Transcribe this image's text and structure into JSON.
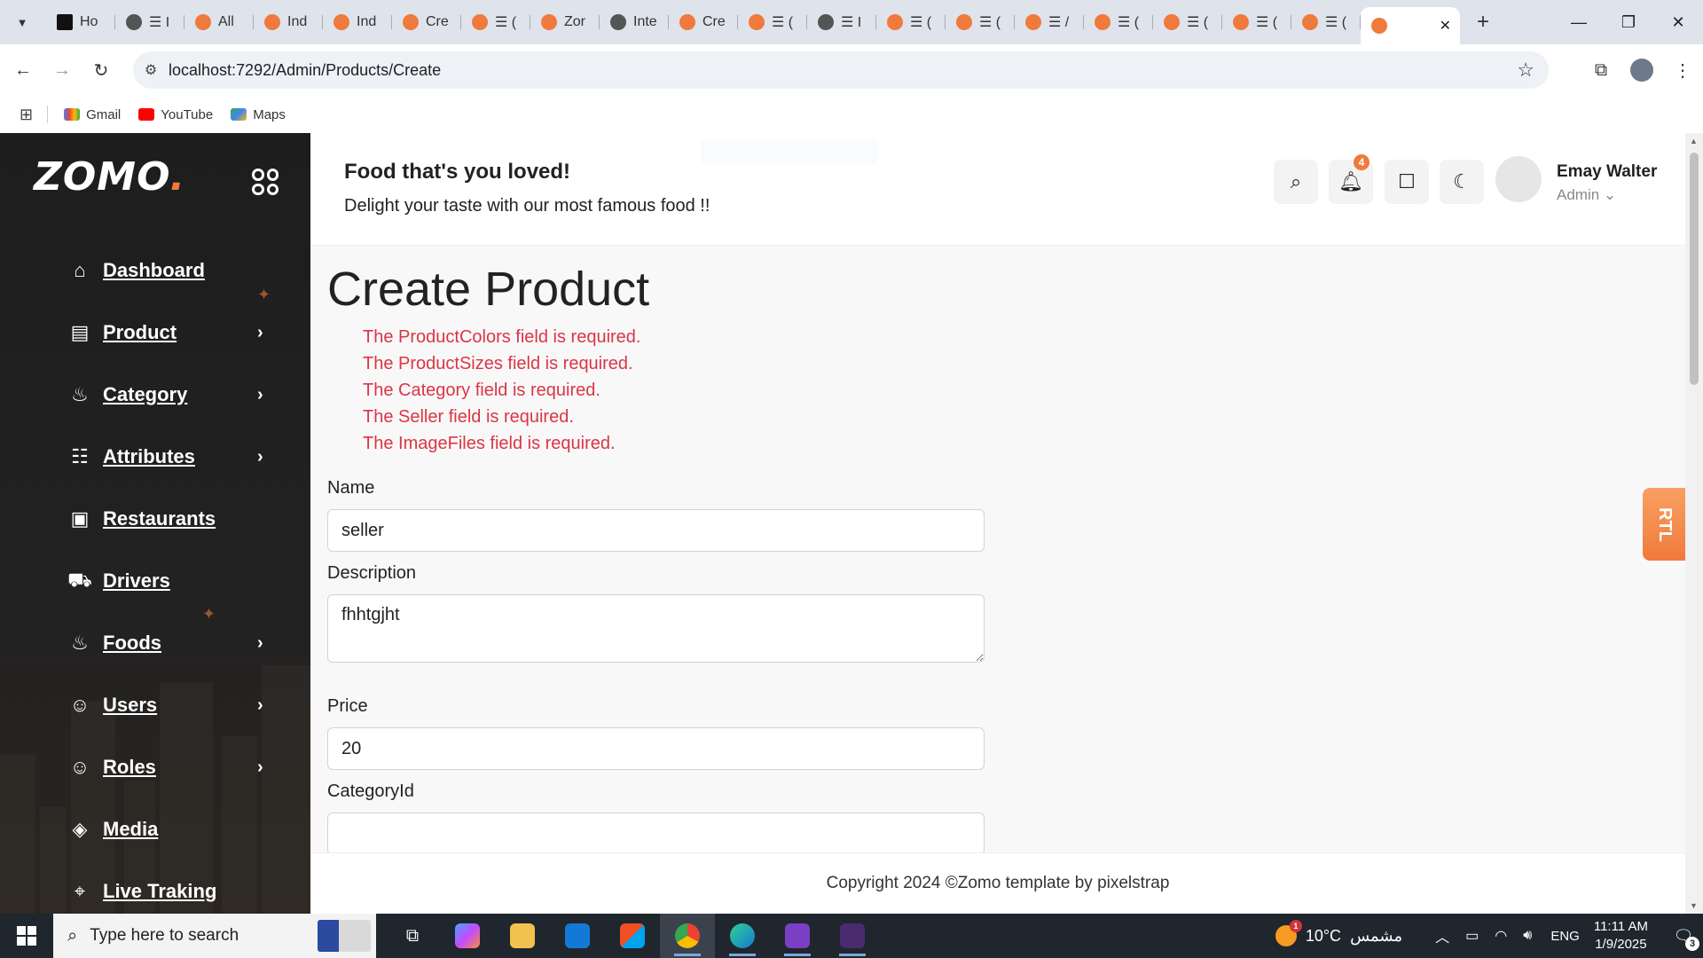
{
  "browser": {
    "tabs": [
      {
        "title": "Ho",
        "favicon": "h-icon"
      },
      {
        "title": "☰ I",
        "favicon": "globe-icon"
      },
      {
        "title": "All",
        "favicon": "zomo-icon"
      },
      {
        "title": "Ind",
        "favicon": "zomo-icon"
      },
      {
        "title": "Ind",
        "favicon": "zomo-icon"
      },
      {
        "title": "Cre",
        "favicon": "zomo-icon"
      },
      {
        "title": "☰ (",
        "favicon": "zomo-icon"
      },
      {
        "title": "Zor",
        "favicon": "zomo-icon"
      },
      {
        "title": "Inte",
        "favicon": "globe-icon"
      },
      {
        "title": "Cre",
        "favicon": "zomo-icon"
      },
      {
        "title": "☰ (",
        "favicon": "zomo-icon"
      },
      {
        "title": "☰ I",
        "favicon": "globe-icon"
      },
      {
        "title": "☰ (",
        "favicon": "zomo-icon"
      },
      {
        "title": "☰ (",
        "favicon": "zomo-icon"
      },
      {
        "title": "☰ /",
        "favicon": "zomo-icon"
      },
      {
        "title": "☰ (",
        "favicon": "zomo-icon"
      },
      {
        "title": "☰ (",
        "favicon": "zomo-icon"
      },
      {
        "title": "☰ (",
        "favicon": "zomo-icon"
      },
      {
        "title": "☰ (",
        "favicon": "zomo-icon"
      }
    ],
    "active_tab_close": "✕",
    "new_tab": "+",
    "url": "localhost:7292/Admin/Products/Create",
    "bookmarks": [
      {
        "label": "Gmail",
        "icon": "gmail-icon"
      },
      {
        "label": "YouTube",
        "icon": "youtube-icon"
      },
      {
        "label": "Maps",
        "icon": "maps-icon"
      }
    ]
  },
  "sidebar": {
    "logo_text": "ZOMO",
    "logo_dot": ".",
    "items": [
      {
        "label": "Dashboard",
        "icon": "home-icon",
        "glyph": "⌂",
        "has_submenu": false
      },
      {
        "label": "Product",
        "icon": "product-icon",
        "glyph": "▤",
        "has_submenu": true
      },
      {
        "label": "Category",
        "icon": "bowl-icon",
        "glyph": "♨",
        "has_submenu": true
      },
      {
        "label": "Attributes",
        "icon": "attributes-icon",
        "glyph": "☷",
        "has_submenu": true
      },
      {
        "label": "Restaurants",
        "icon": "restaurant-icon",
        "glyph": "▣",
        "has_submenu": false
      },
      {
        "label": "Drivers",
        "icon": "car-icon",
        "glyph": "⛟",
        "has_submenu": false
      },
      {
        "label": "Foods",
        "icon": "food-icon",
        "glyph": "♨",
        "has_submenu": true
      },
      {
        "label": "Users",
        "icon": "user-icon",
        "glyph": "☺",
        "has_submenu": true
      },
      {
        "label": "Roles",
        "icon": "role-icon",
        "glyph": "☺",
        "has_submenu": true
      },
      {
        "label": "Media",
        "icon": "tag-icon",
        "glyph": "◈",
        "has_submenu": false
      },
      {
        "label": "Live Traking",
        "icon": "location-icon",
        "glyph": "⌖",
        "has_submenu": false
      }
    ]
  },
  "header": {
    "title": "Food that's you loved!",
    "subtitle": "Delight your taste with our most famous food !!",
    "notification_count": "4",
    "user_name": "Emay Walter",
    "user_role": "Admin",
    "colors": {
      "accent": "#f07a3c"
    }
  },
  "main": {
    "page_title": "Create Product",
    "errors": [
      "The ProductColors field is required.",
      "The ProductSizes field is required.",
      "The Category field is required.",
      "The Seller field is required.",
      "The ImageFiles field is required."
    ],
    "error_color": "#dc3545",
    "fields": {
      "name_label": "Name",
      "name_value": "seller",
      "description_label": "Description",
      "description_value": "fhhtgjht",
      "price_label": "Price",
      "price_value": "20",
      "category_label": "CategoryId"
    },
    "rtl_label": "RTL"
  },
  "footer": {
    "text": "Copyright 2024 ©Zomo template by pixelstrap"
  },
  "taskbar": {
    "search_placeholder": "Type here to search",
    "weather_temp": "10°C",
    "weather_desc": "مشمس",
    "weather_badge": "1",
    "language": "ENG",
    "time": "11:11 AM",
    "date": "1/9/2025",
    "notification_count": "3"
  }
}
